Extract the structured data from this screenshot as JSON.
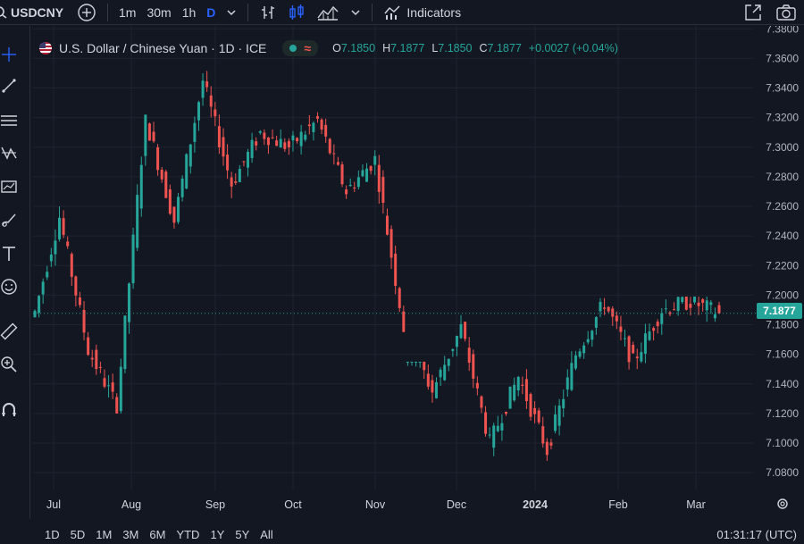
{
  "topbar": {
    "symbol": "USDCNY",
    "add_icon": "plus-circle-icon",
    "intervals": [
      {
        "label": "1m",
        "active": false
      },
      {
        "label": "30m",
        "active": false
      },
      {
        "label": "1h",
        "active": false
      },
      {
        "label": "D",
        "active": true
      }
    ],
    "indicators_label": "Indicators"
  },
  "legend": {
    "title": "U.S. Dollar / Chinese Yuan · 1D · ICE",
    "pill_symbol": "≈",
    "o_label": "O",
    "o_value": "7.1850",
    "h_label": "H",
    "h_value": "7.1877",
    "l_label": "L",
    "l_value": "7.1850",
    "c_label": "C",
    "c_value": "7.1877",
    "change": "+0.0027 (+0.04%)"
  },
  "price_tag": "7.1877",
  "colors": {
    "up": "#26a69a",
    "down": "#ef5350",
    "background": "#131722",
    "grid": "#1f2330",
    "accent": "#2962ff"
  },
  "chart_data": {
    "type": "candlestick",
    "y_ticks": [
      "7.3800",
      "7.3600",
      "7.3400",
      "7.3200",
      "7.3000",
      "7.2800",
      "7.2600",
      "7.2400",
      "7.2200",
      "7.2000",
      "7.1800",
      "7.1600",
      "7.1400",
      "7.1200",
      "7.1000",
      "7.0800"
    ],
    "ylim": [
      7.068,
      7.382
    ],
    "x_labels": [
      "Jul",
      "Aug",
      "Sep",
      "Oct",
      "Nov",
      "Dec",
      "2024",
      "Feb",
      "Mar"
    ],
    "last_price": 7.1877,
    "grid": true,
    "segments": [
      {
        "from": 7.178,
        "to": 7.253,
        "lo": 7.185,
        "hi": 7.26
      },
      {
        "from": 7.253,
        "to": 7.163,
        "lo": 7.14,
        "hi": 7.268
      },
      {
        "from": 7.163,
        "to": 7.125,
        "lo": 7.12,
        "hi": 7.19
      },
      {
        "from": 7.125,
        "to": 7.32,
        "lo": 7.12,
        "hi": 7.322
      },
      {
        "from": 7.32,
        "to": 7.25,
        "lo": 7.245,
        "hi": 7.325
      },
      {
        "from": 7.25,
        "to": 7.345,
        "lo": 7.248,
        "hi": 7.35
      },
      {
        "from": 7.345,
        "to": 7.275,
        "lo": 7.25,
        "hi": 7.352
      },
      {
        "from": 7.275,
        "to": 7.31,
        "lo": 7.27,
        "hi": 7.315
      },
      {
        "from": 7.31,
        "to": 7.3,
        "lo": 7.286,
        "hi": 7.312
      },
      {
        "from": 7.3,
        "to": 7.318,
        "lo": 7.295,
        "hi": 7.324
      },
      {
        "from": 7.318,
        "to": 7.27,
        "lo": 7.265,
        "hi": 7.32
      },
      {
        "from": 7.27,
        "to": 7.292,
        "lo": 7.265,
        "hi": 7.298
      },
      {
        "from": 7.292,
        "to": 7.178,
        "lo": 7.175,
        "hi": 7.295
      },
      {
        "from": 7.178,
        "to": 7.135,
        "lo": 7.12,
        "hi": 7.155
      },
      {
        "from": 7.135,
        "to": 7.178,
        "lo": 7.13,
        "hi": 7.19
      },
      {
        "from": 7.178,
        "to": 7.1,
        "lo": 7.095,
        "hi": 7.182
      },
      {
        "from": 7.1,
        "to": 7.145,
        "lo": 7.09,
        "hi": 7.15
      },
      {
        "from": 7.145,
        "to": 7.095,
        "lo": 7.088,
        "hi": 7.15
      },
      {
        "from": 7.095,
        "to": 7.16,
        "lo": 7.092,
        "hi": 7.165
      },
      {
        "from": 7.16,
        "to": 7.195,
        "lo": 7.155,
        "hi": 7.198
      },
      {
        "from": 7.195,
        "to": 7.155,
        "lo": 7.148,
        "hi": 7.198
      },
      {
        "from": 7.155,
        "to": 7.19,
        "lo": 7.15,
        "hi": 7.198
      },
      {
        "from": 7.19,
        "to": 7.196,
        "lo": 7.182,
        "hi": 7.199
      },
      {
        "from": 7.196,
        "to": 7.1877,
        "lo": 7.182,
        "hi": 7.199
      }
    ]
  },
  "bottombar": {
    "ranges": [
      "1D",
      "5D",
      "1M",
      "3M",
      "6M",
      "YTD",
      "1Y",
      "5Y",
      "All"
    ],
    "time": "01:31:17 (UTC)"
  }
}
